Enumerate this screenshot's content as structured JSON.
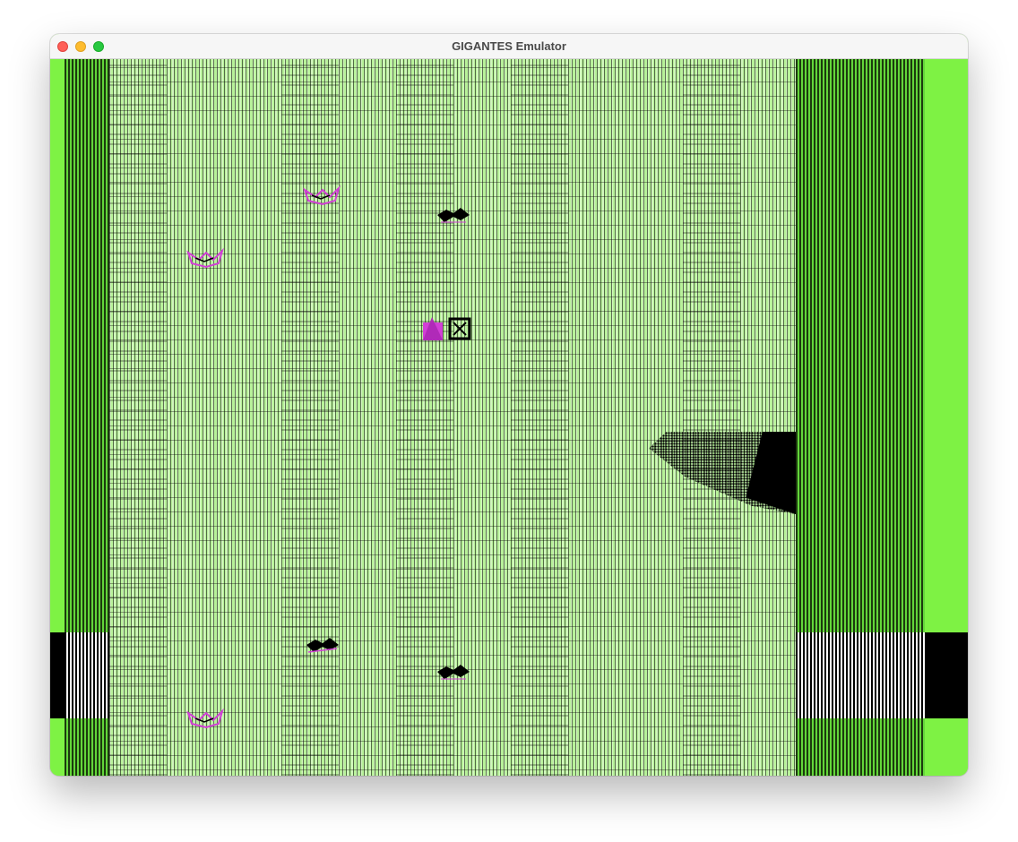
{
  "window": {
    "title": "GIGANTES Emulator"
  },
  "game": {
    "palette": {
      "background_green": "#7ef244",
      "field_light_green": "#b8f29a",
      "dark_stripe": "#1c3a0e",
      "sprite_magenta": "#d23fd6",
      "black": "#000000",
      "white": "#ffffff"
    },
    "sprites": [
      {
        "name": "enemy-ship-magenta"
      },
      {
        "name": "enemy-ship-black"
      },
      {
        "name": "enemy-ship-magenta"
      },
      {
        "name": "player-ship"
      },
      {
        "name": "enemy-ship-black"
      },
      {
        "name": "enemy-ship-black"
      },
      {
        "name": "enemy-ship-magenta"
      }
    ]
  }
}
